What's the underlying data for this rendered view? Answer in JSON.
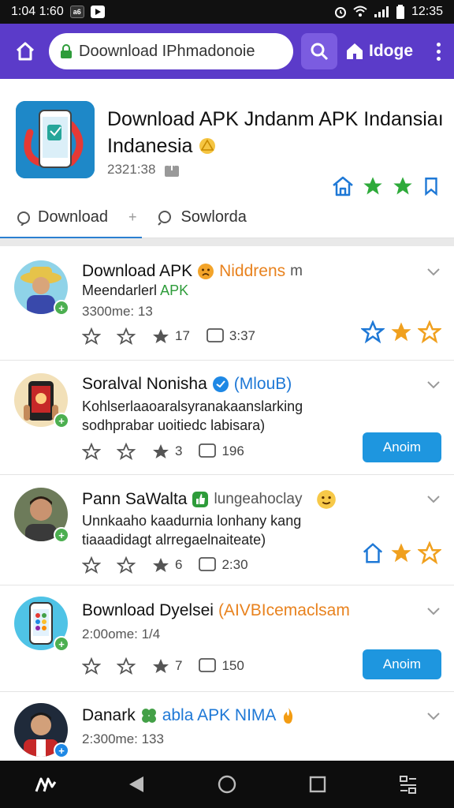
{
  "status_bar": {
    "left_time": "1:04 1:60",
    "badge1": "a6",
    "right_time": "12:35"
  },
  "top_bar": {
    "url": "Doownload IPhmadonoie",
    "home_label": "Idoge"
  },
  "app": {
    "title": "Download APK Jndanm APK Indansiaı Indanesia",
    "date": "2321:38",
    "tabs": [
      {
        "label": "Download"
      },
      {
        "label": "Sowlorda"
      }
    ],
    "tab_sep": "+"
  },
  "items": [
    {
      "title": "Download APK",
      "tag": "Niddrens",
      "tag_suffix": "m",
      "line1": "Meendarlerl",
      "line1_green": "APK",
      "line2": "",
      "time": "3300me: 13",
      "stat_star": "17",
      "stat_comment": "3:37",
      "right": "stars",
      "button": ""
    },
    {
      "title": "Soralval Nonisha",
      "tag": "(MlouB)",
      "tag_suffix": "",
      "line1": "Kohlserlaaoaralsyranakaanslarking",
      "line1_green": "",
      "line2": "sodhprabar uoitiedc labisara)",
      "time": "",
      "stat_star": "3",
      "stat_comment": "196",
      "right": "button",
      "button": "Anoim"
    },
    {
      "title": "Pann SaWalta",
      "tag": "lungeahoclay",
      "tag_suffix": "",
      "line1": "Unnkaaho kaadurnia lonhany kang",
      "line1_green": "",
      "line2": "tiaaadidagt alrregaelnaiteate)",
      "time": "",
      "stat_star": "6",
      "stat_comment": "2:30",
      "right": "stars",
      "button": ""
    },
    {
      "title": "Bownload Dyelsei",
      "tag": "(AIVBIcemaclsam",
      "tag_suffix": "",
      "line1": "",
      "line1_green": "",
      "line2": "",
      "time": "2:00ome: 1/4",
      "stat_star": "7",
      "stat_comment": "150",
      "right": "button",
      "button": "Anoim"
    },
    {
      "title": "Danark",
      "tag": "abla APK NIMA",
      "tag_suffix": "",
      "line1": "",
      "line1_green": "",
      "line2": "",
      "time": "2:300me: 133",
      "stat_star": "",
      "stat_comment": "",
      "right": "none",
      "button": ""
    }
  ],
  "colors": {
    "top_bar": "#5b3bc9",
    "accent_blue": "#1e96df",
    "star_green": "#2eaa3a",
    "star_orange": "#f0a01e"
  }
}
